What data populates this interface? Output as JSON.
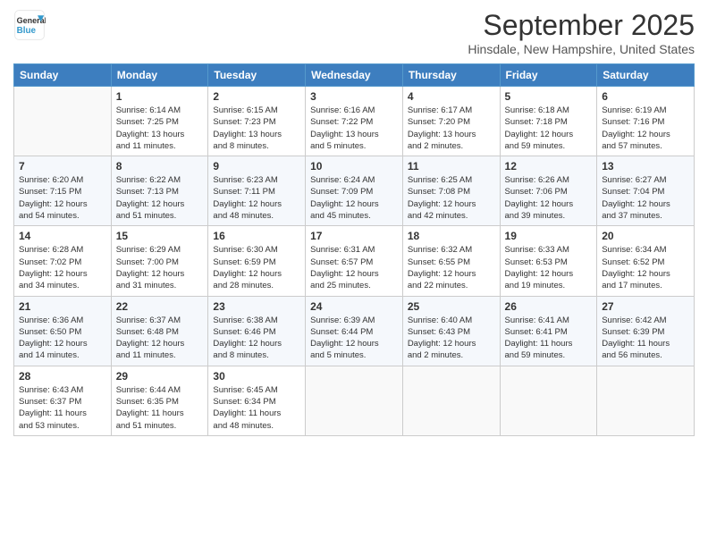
{
  "header": {
    "logo": {
      "line1": "General",
      "line2": "Blue"
    },
    "title": "September 2025",
    "subtitle": "Hinsdale, New Hampshire, United States"
  },
  "weekdays": [
    "Sunday",
    "Monday",
    "Tuesday",
    "Wednesday",
    "Thursday",
    "Friday",
    "Saturday"
  ],
  "weeks": [
    [
      {
        "day": "",
        "info": ""
      },
      {
        "day": "1",
        "info": "Sunrise: 6:14 AM\nSunset: 7:25 PM\nDaylight: 13 hours\nand 11 minutes."
      },
      {
        "day": "2",
        "info": "Sunrise: 6:15 AM\nSunset: 7:23 PM\nDaylight: 13 hours\nand 8 minutes."
      },
      {
        "day": "3",
        "info": "Sunrise: 6:16 AM\nSunset: 7:22 PM\nDaylight: 13 hours\nand 5 minutes."
      },
      {
        "day": "4",
        "info": "Sunrise: 6:17 AM\nSunset: 7:20 PM\nDaylight: 13 hours\nand 2 minutes."
      },
      {
        "day": "5",
        "info": "Sunrise: 6:18 AM\nSunset: 7:18 PM\nDaylight: 12 hours\nand 59 minutes."
      },
      {
        "day": "6",
        "info": "Sunrise: 6:19 AM\nSunset: 7:16 PM\nDaylight: 12 hours\nand 57 minutes."
      }
    ],
    [
      {
        "day": "7",
        "info": "Sunrise: 6:20 AM\nSunset: 7:15 PM\nDaylight: 12 hours\nand 54 minutes."
      },
      {
        "day": "8",
        "info": "Sunrise: 6:22 AM\nSunset: 7:13 PM\nDaylight: 12 hours\nand 51 minutes."
      },
      {
        "day": "9",
        "info": "Sunrise: 6:23 AM\nSunset: 7:11 PM\nDaylight: 12 hours\nand 48 minutes."
      },
      {
        "day": "10",
        "info": "Sunrise: 6:24 AM\nSunset: 7:09 PM\nDaylight: 12 hours\nand 45 minutes."
      },
      {
        "day": "11",
        "info": "Sunrise: 6:25 AM\nSunset: 7:08 PM\nDaylight: 12 hours\nand 42 minutes."
      },
      {
        "day": "12",
        "info": "Sunrise: 6:26 AM\nSunset: 7:06 PM\nDaylight: 12 hours\nand 39 minutes."
      },
      {
        "day": "13",
        "info": "Sunrise: 6:27 AM\nSunset: 7:04 PM\nDaylight: 12 hours\nand 37 minutes."
      }
    ],
    [
      {
        "day": "14",
        "info": "Sunrise: 6:28 AM\nSunset: 7:02 PM\nDaylight: 12 hours\nand 34 minutes."
      },
      {
        "day": "15",
        "info": "Sunrise: 6:29 AM\nSunset: 7:00 PM\nDaylight: 12 hours\nand 31 minutes."
      },
      {
        "day": "16",
        "info": "Sunrise: 6:30 AM\nSunset: 6:59 PM\nDaylight: 12 hours\nand 28 minutes."
      },
      {
        "day": "17",
        "info": "Sunrise: 6:31 AM\nSunset: 6:57 PM\nDaylight: 12 hours\nand 25 minutes."
      },
      {
        "day": "18",
        "info": "Sunrise: 6:32 AM\nSunset: 6:55 PM\nDaylight: 12 hours\nand 22 minutes."
      },
      {
        "day": "19",
        "info": "Sunrise: 6:33 AM\nSunset: 6:53 PM\nDaylight: 12 hours\nand 19 minutes."
      },
      {
        "day": "20",
        "info": "Sunrise: 6:34 AM\nSunset: 6:52 PM\nDaylight: 12 hours\nand 17 minutes."
      }
    ],
    [
      {
        "day": "21",
        "info": "Sunrise: 6:36 AM\nSunset: 6:50 PM\nDaylight: 12 hours\nand 14 minutes."
      },
      {
        "day": "22",
        "info": "Sunrise: 6:37 AM\nSunset: 6:48 PM\nDaylight: 12 hours\nand 11 minutes."
      },
      {
        "day": "23",
        "info": "Sunrise: 6:38 AM\nSunset: 6:46 PM\nDaylight: 12 hours\nand 8 minutes."
      },
      {
        "day": "24",
        "info": "Sunrise: 6:39 AM\nSunset: 6:44 PM\nDaylight: 12 hours\nand 5 minutes."
      },
      {
        "day": "25",
        "info": "Sunrise: 6:40 AM\nSunset: 6:43 PM\nDaylight: 12 hours\nand 2 minutes."
      },
      {
        "day": "26",
        "info": "Sunrise: 6:41 AM\nSunset: 6:41 PM\nDaylight: 11 hours\nand 59 minutes."
      },
      {
        "day": "27",
        "info": "Sunrise: 6:42 AM\nSunset: 6:39 PM\nDaylight: 11 hours\nand 56 minutes."
      }
    ],
    [
      {
        "day": "28",
        "info": "Sunrise: 6:43 AM\nSunset: 6:37 PM\nDaylight: 11 hours\nand 53 minutes."
      },
      {
        "day": "29",
        "info": "Sunrise: 6:44 AM\nSunset: 6:35 PM\nDaylight: 11 hours\nand 51 minutes."
      },
      {
        "day": "30",
        "info": "Sunrise: 6:45 AM\nSunset: 6:34 PM\nDaylight: 11 hours\nand 48 minutes."
      },
      {
        "day": "",
        "info": ""
      },
      {
        "day": "",
        "info": ""
      },
      {
        "day": "",
        "info": ""
      },
      {
        "day": "",
        "info": ""
      }
    ]
  ]
}
